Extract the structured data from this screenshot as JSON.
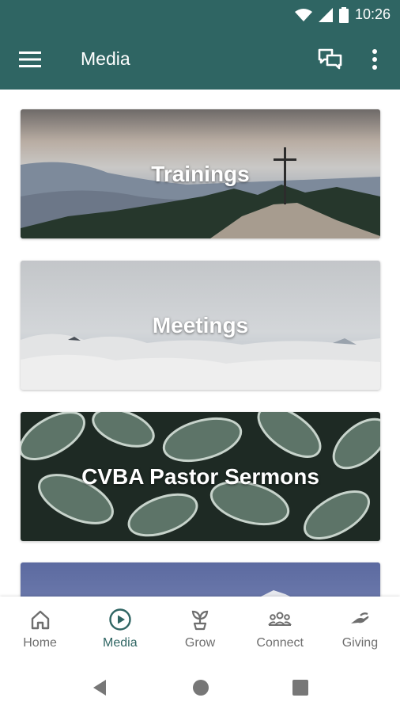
{
  "status_bar": {
    "time": "10:26"
  },
  "app_bar": {
    "title": "Media"
  },
  "cards": [
    {
      "label": "Trainings"
    },
    {
      "label": "Meetings"
    },
    {
      "label": "CVBA Pastor Sermons"
    },
    {
      "label": ""
    }
  ],
  "bottom_nav": {
    "items": [
      {
        "label": "Home",
        "icon": "home-icon"
      },
      {
        "label": "Media",
        "icon": "play-circle-icon",
        "active": true
      },
      {
        "label": "Grow",
        "icon": "sprout-icon"
      },
      {
        "label": "Connect",
        "icon": "group-icon"
      },
      {
        "label": "Giving",
        "icon": "giving-hand-icon"
      }
    ]
  },
  "colors": {
    "primary": "#2f6563",
    "inactive": "#6e6e6e"
  }
}
